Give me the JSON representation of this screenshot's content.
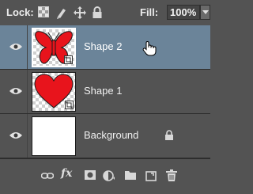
{
  "lock": {
    "label": "Lock:",
    "icons": [
      "lock-transparent-pixels-icon",
      "lock-image-pixels-icon",
      "lock-position-icon",
      "lock-all-icon"
    ]
  },
  "fill": {
    "label": "Fill:",
    "value": "100%",
    "dropdown_icon": "chevron-down-icon"
  },
  "layers": [
    {
      "name": "Shape 2",
      "selected": true,
      "visible": true,
      "thumbnail": "red-butterfly-shape",
      "locked": false
    },
    {
      "name": "Shape 1",
      "selected": false,
      "visible": true,
      "thumbnail": "red-heart-shape",
      "locked": false
    },
    {
      "name": "Background",
      "selected": false,
      "visible": true,
      "thumbnail": "white-fill",
      "locked": true
    }
  ],
  "footer_icons": [
    "link-layers-icon",
    "fx-icon",
    "layer-mask-icon",
    "adjustment-layer-icon",
    "new-group-icon",
    "new-layer-icon",
    "delete-layer-icon"
  ],
  "footer": {
    "fx_label": "fx"
  },
  "colors": {
    "panel": "#535353",
    "selected_row": "#6b8499",
    "shape_fill": "#e8141c"
  }
}
